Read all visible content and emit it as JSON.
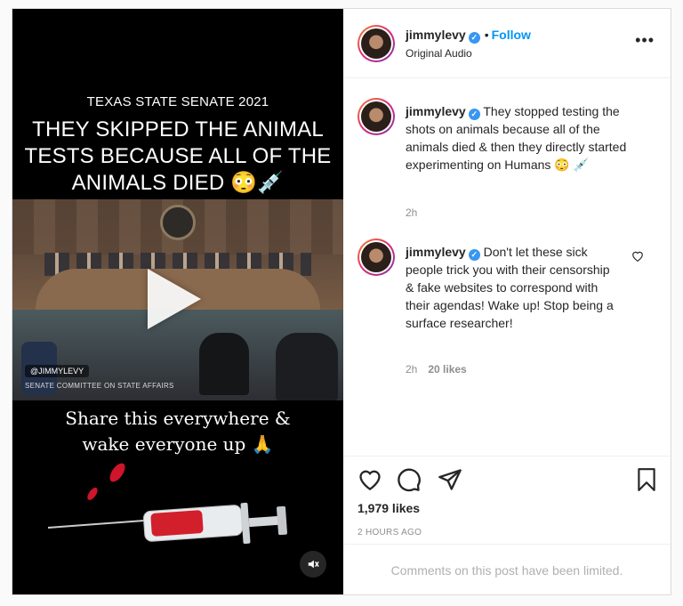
{
  "post": {
    "username": "jimmylevy",
    "follow_label": "Follow",
    "audio_label": "Original Audio",
    "more_label": "•••"
  },
  "media": {
    "kicker": "TEXAS STATE SENATE 2021",
    "headline_line1": "THEY SKIPPED THE ANIMAL",
    "headline_line2": "TESTS BECAUSE ALL OF THE",
    "headline_line3": "ANIMALS DIED 😳💉",
    "watermark": "@JIMMYLEVY",
    "committee": "SENATE COMMITTEE ON STATE AFFAIRS",
    "share_line1": "Share this everywhere &",
    "share_line2": "wake everyone up 🙏",
    "play_icon": "play-icon",
    "mute_icon": "speaker-muted-icon"
  },
  "comments": [
    {
      "username": "jimmylevy",
      "text": "They stopped testing the shots on animals because all of the animals died & then they directly started experimenting on Humans 😳 💉",
      "time": "2h",
      "likes": ""
    },
    {
      "username": "jimmylevy",
      "text": "Don't let these sick people trick you with their censorship & fake websites to correspond with their agendas! Wake up! Stop being a surface researcher!",
      "time": "2h",
      "likes": "20 likes"
    }
  ],
  "actions": {
    "likes": "1,979 likes",
    "time": "2 HOURS AGO",
    "limited": "Comments on this post have been limited.",
    "icons": [
      "heart-icon",
      "comment-icon",
      "share-icon",
      "bookmark-icon"
    ]
  }
}
